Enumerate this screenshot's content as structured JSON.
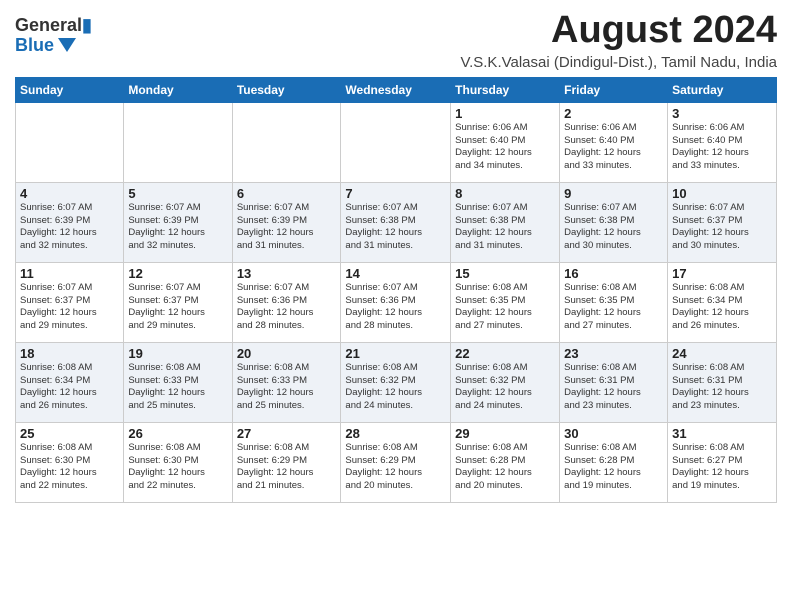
{
  "header": {
    "logo_line1": "General",
    "logo_line2": "Blue",
    "month": "August 2024",
    "location": "V.S.K.Valasai (Dindigul-Dist.), Tamil Nadu, India"
  },
  "weekdays": [
    "Sunday",
    "Monday",
    "Tuesday",
    "Wednesday",
    "Thursday",
    "Friday",
    "Saturday"
  ],
  "weeks": [
    [
      {
        "day": "",
        "info": ""
      },
      {
        "day": "",
        "info": ""
      },
      {
        "day": "",
        "info": ""
      },
      {
        "day": "",
        "info": ""
      },
      {
        "day": "1",
        "info": "Sunrise: 6:06 AM\nSunset: 6:40 PM\nDaylight: 12 hours\nand 34 minutes."
      },
      {
        "day": "2",
        "info": "Sunrise: 6:06 AM\nSunset: 6:40 PM\nDaylight: 12 hours\nand 33 minutes."
      },
      {
        "day": "3",
        "info": "Sunrise: 6:06 AM\nSunset: 6:40 PM\nDaylight: 12 hours\nand 33 minutes."
      }
    ],
    [
      {
        "day": "4",
        "info": "Sunrise: 6:07 AM\nSunset: 6:39 PM\nDaylight: 12 hours\nand 32 minutes."
      },
      {
        "day": "5",
        "info": "Sunrise: 6:07 AM\nSunset: 6:39 PM\nDaylight: 12 hours\nand 32 minutes."
      },
      {
        "day": "6",
        "info": "Sunrise: 6:07 AM\nSunset: 6:39 PM\nDaylight: 12 hours\nand 31 minutes."
      },
      {
        "day": "7",
        "info": "Sunrise: 6:07 AM\nSunset: 6:38 PM\nDaylight: 12 hours\nand 31 minutes."
      },
      {
        "day": "8",
        "info": "Sunrise: 6:07 AM\nSunset: 6:38 PM\nDaylight: 12 hours\nand 31 minutes."
      },
      {
        "day": "9",
        "info": "Sunrise: 6:07 AM\nSunset: 6:38 PM\nDaylight: 12 hours\nand 30 minutes."
      },
      {
        "day": "10",
        "info": "Sunrise: 6:07 AM\nSunset: 6:37 PM\nDaylight: 12 hours\nand 30 minutes."
      }
    ],
    [
      {
        "day": "11",
        "info": "Sunrise: 6:07 AM\nSunset: 6:37 PM\nDaylight: 12 hours\nand 29 minutes."
      },
      {
        "day": "12",
        "info": "Sunrise: 6:07 AM\nSunset: 6:37 PM\nDaylight: 12 hours\nand 29 minutes."
      },
      {
        "day": "13",
        "info": "Sunrise: 6:07 AM\nSunset: 6:36 PM\nDaylight: 12 hours\nand 28 minutes."
      },
      {
        "day": "14",
        "info": "Sunrise: 6:07 AM\nSunset: 6:36 PM\nDaylight: 12 hours\nand 28 minutes."
      },
      {
        "day": "15",
        "info": "Sunrise: 6:08 AM\nSunset: 6:35 PM\nDaylight: 12 hours\nand 27 minutes."
      },
      {
        "day": "16",
        "info": "Sunrise: 6:08 AM\nSunset: 6:35 PM\nDaylight: 12 hours\nand 27 minutes."
      },
      {
        "day": "17",
        "info": "Sunrise: 6:08 AM\nSunset: 6:34 PM\nDaylight: 12 hours\nand 26 minutes."
      }
    ],
    [
      {
        "day": "18",
        "info": "Sunrise: 6:08 AM\nSunset: 6:34 PM\nDaylight: 12 hours\nand 26 minutes."
      },
      {
        "day": "19",
        "info": "Sunrise: 6:08 AM\nSunset: 6:33 PM\nDaylight: 12 hours\nand 25 minutes."
      },
      {
        "day": "20",
        "info": "Sunrise: 6:08 AM\nSunset: 6:33 PM\nDaylight: 12 hours\nand 25 minutes."
      },
      {
        "day": "21",
        "info": "Sunrise: 6:08 AM\nSunset: 6:32 PM\nDaylight: 12 hours\nand 24 minutes."
      },
      {
        "day": "22",
        "info": "Sunrise: 6:08 AM\nSunset: 6:32 PM\nDaylight: 12 hours\nand 24 minutes."
      },
      {
        "day": "23",
        "info": "Sunrise: 6:08 AM\nSunset: 6:31 PM\nDaylight: 12 hours\nand 23 minutes."
      },
      {
        "day": "24",
        "info": "Sunrise: 6:08 AM\nSunset: 6:31 PM\nDaylight: 12 hours\nand 23 minutes."
      }
    ],
    [
      {
        "day": "25",
        "info": "Sunrise: 6:08 AM\nSunset: 6:30 PM\nDaylight: 12 hours\nand 22 minutes."
      },
      {
        "day": "26",
        "info": "Sunrise: 6:08 AM\nSunset: 6:30 PM\nDaylight: 12 hours\nand 22 minutes."
      },
      {
        "day": "27",
        "info": "Sunrise: 6:08 AM\nSunset: 6:29 PM\nDaylight: 12 hours\nand 21 minutes."
      },
      {
        "day": "28",
        "info": "Sunrise: 6:08 AM\nSunset: 6:29 PM\nDaylight: 12 hours\nand 20 minutes."
      },
      {
        "day": "29",
        "info": "Sunrise: 6:08 AM\nSunset: 6:28 PM\nDaylight: 12 hours\nand 20 minutes."
      },
      {
        "day": "30",
        "info": "Sunrise: 6:08 AM\nSunset: 6:28 PM\nDaylight: 12 hours\nand 19 minutes."
      },
      {
        "day": "31",
        "info": "Sunrise: 6:08 AM\nSunset: 6:27 PM\nDaylight: 12 hours\nand 19 minutes."
      }
    ]
  ]
}
